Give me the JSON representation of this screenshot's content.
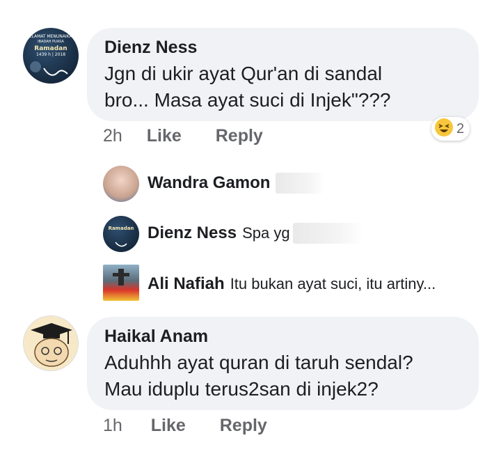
{
  "comments": [
    {
      "author": "Dienz Ness",
      "text_line1": "Jgn di ukir ayat Qur'an di sandal",
      "text_line2": "bro...  Masa ayat suci di Injek\"???",
      "time": "2h",
      "like": "Like",
      "reply": "Reply",
      "reaction_count": "2",
      "avatar": {
        "line1": "SELAMAT MENUNAIKAN",
        "line2": "IBADAH PUASA",
        "line3": "Ramadan",
        "line4": "1439 h | 2018"
      }
    },
    {
      "author": "Haikal Anam",
      "text_line1": "Aduhhh ayat quran di taruh sendal?",
      "text_line2": "Mau iduplu terus2san di injek2?",
      "time": "1h",
      "like": "Like",
      "reply": "Reply"
    }
  ],
  "replies": [
    {
      "author": "Wandra Gamon",
      "text": ""
    },
    {
      "author": "Dienz Ness",
      "text": "Spa yg"
    },
    {
      "author": "Ali Nafiah",
      "text": "Itu bukan ayat suci, itu artiny..."
    }
  ],
  "colors": {
    "bubble": "#f0f2f5",
    "muted": "#65676b",
    "text": "#1c1e21"
  }
}
